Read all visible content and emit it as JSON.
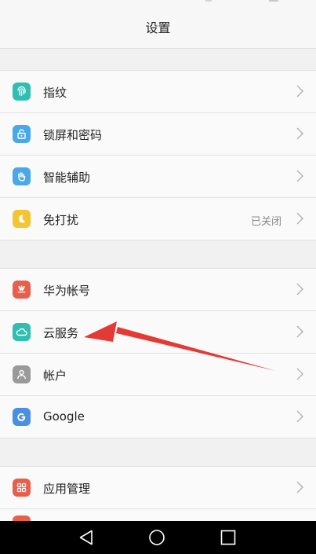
{
  "header": {
    "title": "设置"
  },
  "groups": [
    {
      "items": [
        {
          "label": "指纹",
          "icon": "fingerprint-icon",
          "color": "#2fbfb1"
        },
        {
          "label": "锁屏和密码",
          "icon": "lock-icon",
          "color": "#4aa8e8"
        },
        {
          "label": "智能辅助",
          "icon": "hand-icon",
          "color": "#4aa8e8"
        },
        {
          "label": "免打扰",
          "icon": "moon-icon",
          "color": "#f4c532",
          "value": "已关闭"
        }
      ]
    },
    {
      "items": [
        {
          "label": "华为帐号",
          "icon": "huawei-icon",
          "color": "#e8604c"
        },
        {
          "label": "云服务",
          "icon": "cloud-icon",
          "color": "#2fbfb1"
        },
        {
          "label": "帐户",
          "icon": "person-icon",
          "color": "#9a9a9a"
        },
        {
          "label": "Google",
          "icon": "google-icon",
          "color": "#4a90e2"
        }
      ]
    },
    {
      "items": [
        {
          "label": "应用管理",
          "icon": "apps-icon",
          "color": "#e8604c"
        }
      ]
    }
  ],
  "annotation": {
    "color": "#e53935"
  },
  "navbar": {
    "icons": [
      "back-icon",
      "home-icon",
      "recents-icon"
    ]
  }
}
